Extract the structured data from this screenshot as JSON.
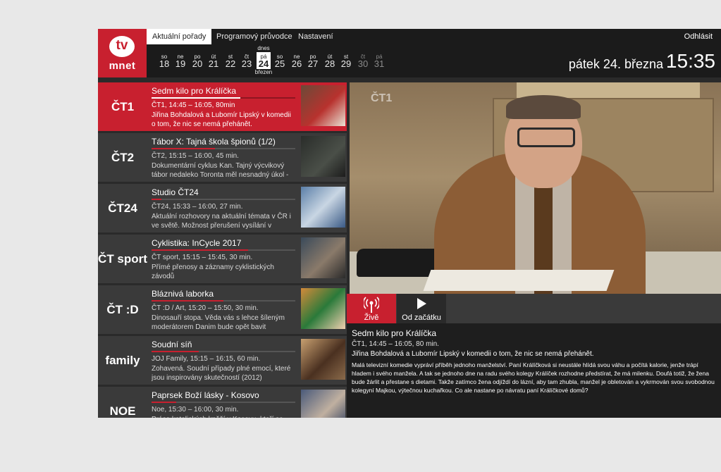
{
  "nav": {
    "tabs": [
      {
        "label": "Aktuální pořady",
        "active": true
      },
      {
        "label": "Programový průvodce"
      },
      {
        "label": "Nastavení"
      }
    ],
    "logout": "Odhlásit"
  },
  "logo": {
    "top": "tv",
    "bottom": "mnet"
  },
  "dates": {
    "today_top": "dnes",
    "today_bottom": "březen",
    "days": [
      {
        "dn": "so",
        "num": "18"
      },
      {
        "dn": "ne",
        "num": "19"
      },
      {
        "dn": "po",
        "num": "20"
      },
      {
        "dn": "út",
        "num": "21"
      },
      {
        "dn": "st",
        "num": "22"
      },
      {
        "dn": "čt",
        "num": "23"
      },
      {
        "dn": "pá",
        "num": "24"
      },
      {
        "dn": "so",
        "num": "25"
      },
      {
        "dn": "ne",
        "num": "26"
      },
      {
        "dn": "po",
        "num": "27"
      },
      {
        "dn": "út",
        "num": "28"
      },
      {
        "dn": "st",
        "num": "29"
      },
      {
        "dn": "čt",
        "num": "30"
      },
      {
        "dn": "pá",
        "num": "31"
      }
    ],
    "current_date": "pátek 24. března",
    "current_time": "15:35"
  },
  "channels": [
    {
      "logo": "ČT1",
      "title": "Sedm kilo pro Králíčka",
      "meta": "ČT1, 14:45 – 16:05, 80min",
      "desc": "Jiřina Bohdalová a Lubomír Lipský v komedii o tom, že nic se nemá přehánět.",
      "progress": 0.62,
      "active": true
    },
    {
      "logo": "ČT2",
      "title": "Tábor X: Tajná škola špionů (1/2)",
      "meta": "ČT2, 15:15 – 16:00, 45 min.",
      "desc": "Dokumentární cyklus Kan. Tajný výcvikový tábor nedaleko Toronta měl nesnadný úkol -",
      "progress": 0.44
    },
    {
      "logo": "ČT24",
      "title": "Studio ČT24",
      "meta": "ČT24, 15:33 – 16:00, 27 min.",
      "desc": "Aktuální rozhovory na aktuální témata v ČR i ve světě. Možnost přerušení vysílání v",
      "progress": 0.07
    },
    {
      "logo": "ČT sport",
      "title": "Cyklistika: InCycle 2017",
      "meta": "ČT sport, 15:15 – 15:45, 30 min.",
      "desc": "Přímé přenosy a záznamy cyklistických závodů",
      "progress": 0.67
    },
    {
      "logo": "ČT :D",
      "title": "Bláznivá laborka",
      "meta": "ČT :D / Art, 15:20 – 15:50, 30 min.",
      "desc": "Dinosauří stopa. Věda vás s lehce šíleným moderátorem Danim bude opět bavit",
      "progress": 0.5
    },
    {
      "logo": "family",
      "title": "Soudní síň",
      "meta": "JOJ Family, 15:15 – 16:15, 60 min.",
      "desc": "Zohavená. Soudní případy plné emocí, které jsou inspirovány skutečností (2012)",
      "progress": 0.33
    },
    {
      "logo": "NOE",
      "title": "Paprsek Boží lásky - Kosovo",
      "meta": "Noe, 15:30 – 16:00, 30 min.",
      "desc": "Práce katolických kněží v Kosovu, kteří se",
      "progress": 0.17
    }
  ],
  "controls": {
    "live": "Živě",
    "start": "Od začátku"
  },
  "player": {
    "watermark": "ČT1"
  },
  "detail": {
    "title": "Sedm kilo pro Králíčka",
    "meta": "ČT1, 14:45 – 16:05, 80 min.",
    "subtitle": "Jiřina Bohdalová a Lubomír Lipský v komedii o tom, že nic se nemá přehánět.",
    "description": "Malá televizní komedie vypráví příběh jednoho manželství. Paní Králíčková si neustále hlídá svou váhu a počítá kalorie, jenže trápí hladem i svého manžela. A tak se jednoho dne na radu svého kolegy Králíček rozhodne předstírat, že má milenku. Doufá totiž, že žena bude žárlit a přestane s dietami. Takže zatímco žena odjíždí do lázní, aby tam zhubla, manžel je obletován a vykrmován svou svobodnou kolegyní Majkou, výtečnou kuchařkou. Co ale nastane po návratu paní Králíčkové domů?"
  },
  "colors": {
    "accent": "#c8202f",
    "dark": "#1b1b1b",
    "row": "#3a3a3a"
  }
}
